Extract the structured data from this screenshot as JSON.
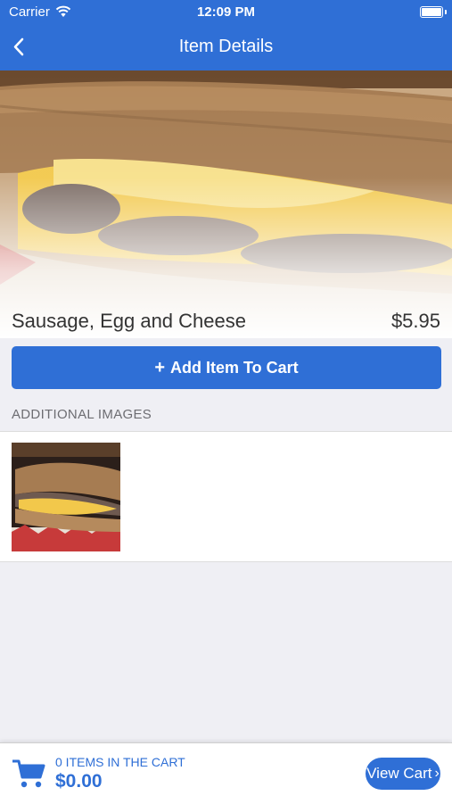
{
  "status_bar": {
    "carrier": "Carrier",
    "time": "12:09 PM"
  },
  "nav": {
    "title": "Item Details",
    "back_icon": "chevron-left-icon"
  },
  "item": {
    "name": "Sausage, Egg and Cheese",
    "price": "$5.95"
  },
  "actions": {
    "add_to_cart_label": "Add Item To Cart",
    "add_icon": "plus-icon"
  },
  "additional_images": {
    "header": "ADDITIONAL IMAGES"
  },
  "cart": {
    "count_label": "0 ITEMS IN THE CART",
    "total": "$0.00",
    "view_cart_label": "View Cart",
    "cart_icon": "shopping-cart-icon"
  },
  "colors": {
    "brand_blue": "#2f6fd6",
    "background": "#efeff4"
  }
}
